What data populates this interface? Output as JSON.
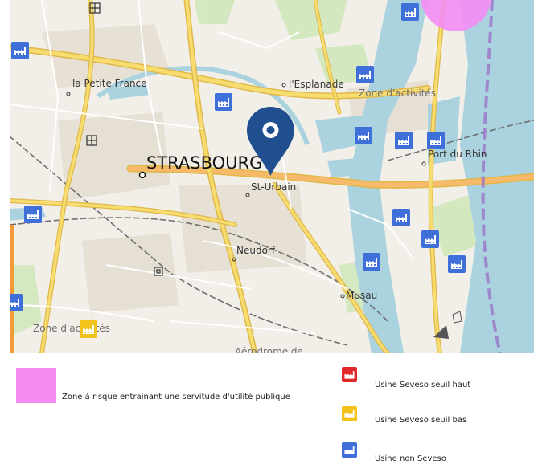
{
  "map": {
    "labels": {
      "city": "STRASBOURG",
      "petite_france": "la Petite France",
      "esplanade": "l'Esplanade",
      "zone_activites_ne": "Zone d'activités",
      "port_du_rhin": "Port du Rhin",
      "st_urbain": "St-Urbain",
      "neudorf": "Neudorf",
      "musau": "Musau",
      "zone_activites_sw": "Zone d'activités",
      "aerodrome": "Aérodrome de"
    },
    "colors": {
      "land": "#f2efe9",
      "water": "#aad3df",
      "major_road": "#f7dc6f",
      "road_outline": "#e0b84a",
      "rail": "#707070",
      "risk_zone": "#f48cf4",
      "marker": "#1f4f8f",
      "factory_non_seveso": "#3f6fd9",
      "factory_low": "#f2c31b",
      "factory_high": "#e2282b"
    }
  },
  "legend": {
    "risk_zone": "Zone à risque entrainant une servitude d'utilité publique",
    "seveso_high": "Usine Seveso seuil haut",
    "seveso_low": "Usine Seveso seuil bas",
    "non_seveso": "Usine non Seveso"
  }
}
